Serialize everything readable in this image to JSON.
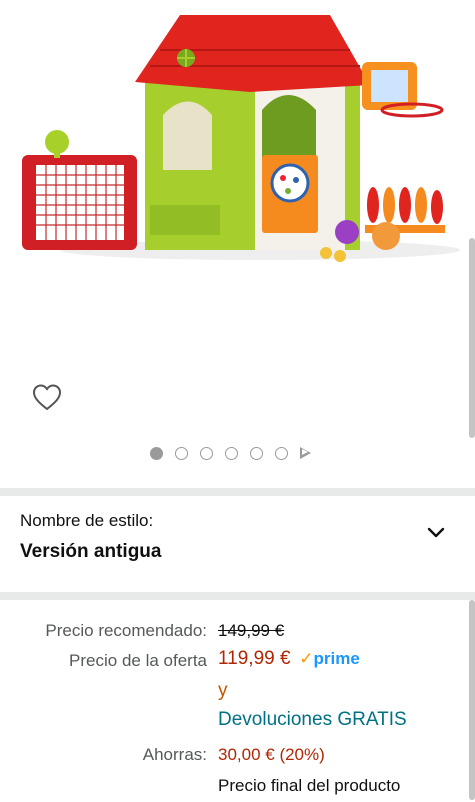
{
  "product": {
    "image_alt": "Casa de juegos infantil multiactividad",
    "wishlist_icon": "heart-outline-icon",
    "carousel": {
      "count": 6,
      "active": 0,
      "has_video": true
    }
  },
  "style_selector": {
    "label": "Nombre de estilo:",
    "value": "Versión antigua",
    "icon": "chevron-down-icon"
  },
  "pricing": {
    "list_label": "Precio recomendado:",
    "list_price": "149,99 €",
    "offer_label": "Precio de la oferta",
    "offer_price": "119,99 €",
    "prime_check": "✓",
    "prime_label": "prime",
    "conjunction": "y",
    "returns_text": "Devoluciones GRATIS",
    "savings_label": "Ahorras:",
    "savings_value": "30,00 € (20%)",
    "final_text": "Precio final del producto"
  },
  "colors": {
    "price_red": "#b12704",
    "link_teal": "#007185",
    "prime_blue": "#1a98ff",
    "prime_orange": "#ff9900"
  }
}
